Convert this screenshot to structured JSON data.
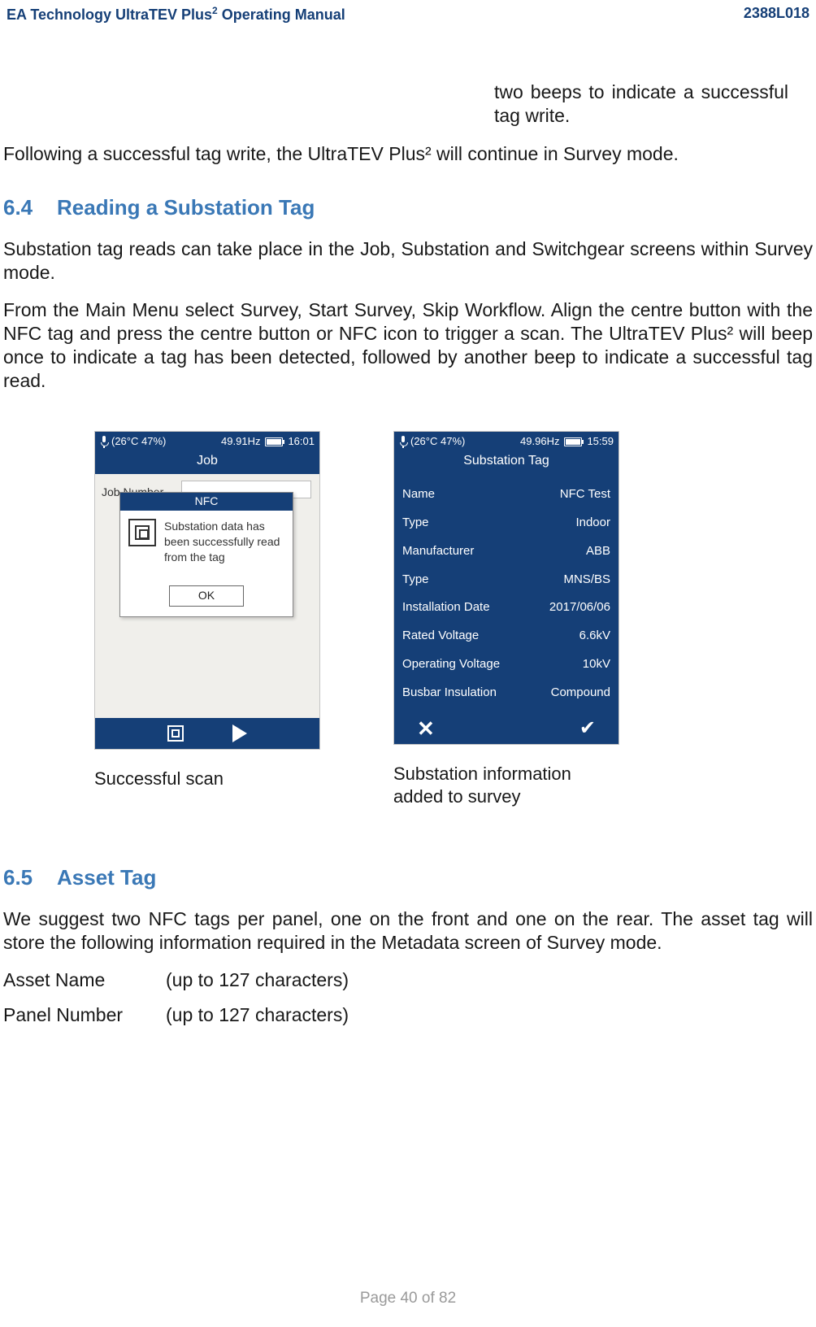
{
  "header": {
    "left_prefix": "EA Technology UltraTEV Plus",
    "left_suffix": " Operating Manual",
    "sup": "2",
    "right": "2388L018"
  },
  "top_fragment": "two beeps to indicate a successful tag write.",
  "para1": "Following a successful tag write, the UltraTEV Plus² will continue in Survey mode.",
  "sec64": {
    "num": "6.4",
    "title": "Reading a Substation Tag"
  },
  "para2": "Substation tag reads can take place in the Job, Substation and Switchgear screens within Survey mode.",
  "para3": "From the Main Menu select Survey, Start Survey, Skip Workflow.  Align the centre button with the NFC tag and press the centre button or NFC icon to trigger a scan.  The UltraTEV Plus² will beep once to indicate a tag has been detected, followed by another beep to indicate a successful tag read.",
  "device1": {
    "status": {
      "temp": "(26°C  47%)",
      "freq": "49.91Hz",
      "time": "16:01",
      "batt_pct": 90
    },
    "title": "Job",
    "jobnum_label": "Job Number",
    "dialog": {
      "title": "NFC",
      "msg": "Substation data has been successfully read from the tag",
      "ok": "OK"
    }
  },
  "device2": {
    "status": {
      "temp": "(26°C  47%)",
      "freq": "49.96Hz",
      "time": "15:59",
      "batt_pct": 90
    },
    "title": "Substation Tag",
    "rows": [
      {
        "k": "Name",
        "v": "NFC Test"
      },
      {
        "k": "Type",
        "v": "Indoor"
      },
      {
        "k": "Manufacturer",
        "v": "ABB"
      },
      {
        "k": "Type",
        "v": "MNS/BS"
      },
      {
        "k": "Installation Date",
        "v": "2017/06/06"
      },
      {
        "k": "Rated Voltage",
        "v": "6.6kV"
      },
      {
        "k": "Operating Voltage",
        "v": "10kV"
      },
      {
        "k": "Busbar Insulation",
        "v": "Compound"
      }
    ]
  },
  "caption1": "Successful scan",
  "caption2a": "Substation information",
  "caption2b": "added to survey",
  "sec65": {
    "num": "6.5",
    "title": "Asset Tag"
  },
  "para4": "We suggest two NFC tags per panel, one on the front and one on the rear.  The asset tag will store the following information required in the Metadata screen of Survey mode.",
  "attrs": [
    {
      "k": "Asset Name",
      "v": "(up to 127 characters)"
    },
    {
      "k": "Panel Number",
      "v": "(up to 127 characters)"
    }
  ],
  "footer": "Page 40 of 82"
}
